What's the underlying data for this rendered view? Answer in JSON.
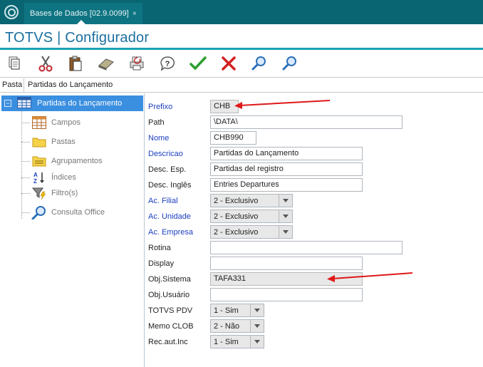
{
  "tab": {
    "label": "Bases de Dados [02.9.0099]",
    "close": "×"
  },
  "app": {
    "title": "TOTVS | Configurador"
  },
  "toolbar": {
    "icons": [
      "copy-icon",
      "cut-icon",
      "paste-icon",
      "eraser-icon",
      "print-icon",
      "help-icon",
      "confirm-icon",
      "cancel-icon",
      "search-icon",
      "search-next-icon"
    ]
  },
  "pasta": {
    "label": "Pasta",
    "value": "Partidas do Lançamento"
  },
  "tree": {
    "root": "Partidas do Lançamento",
    "children": [
      "Campos",
      "Pastas",
      "Agrupamentos",
      "Índices",
      "Filtro(s)",
      "Consulta Office"
    ]
  },
  "form": {
    "prefixo": {
      "label": "Prefixo",
      "value": "CHB"
    },
    "path": {
      "label": "Path",
      "value": "\\DATA\\"
    },
    "nome": {
      "label": "Nome",
      "value": "CHB990"
    },
    "descricao": {
      "label": "Descricao",
      "value": "Partidas do Lançamento"
    },
    "desc_esp": {
      "label": "Desc. Esp.",
      "value": "Partidas del registro"
    },
    "desc_ing": {
      "label": "Desc. Inglês",
      "value": "Entries Departures"
    },
    "ac_filial": {
      "label": "Ac. Filial",
      "value": "2 - Exclusivo"
    },
    "ac_unidade": {
      "label": "Ac. Unidade",
      "value": "2 - Exclusivo"
    },
    "ac_empresa": {
      "label": "Ac. Empresa",
      "value": "2 - Exclusivo"
    },
    "rotina": {
      "label": "Rotina",
      "value": ""
    },
    "display": {
      "label": "Display",
      "value": ""
    },
    "obj_sistema": {
      "label": "Obj.Sistema",
      "value": "TAFA331"
    },
    "obj_usuario": {
      "label": "Obj.Usuário",
      "value": ""
    },
    "totvs_pdv": {
      "label": "TOTVS PDV",
      "value": "1 - Sim"
    },
    "memo_clob": {
      "label": "Memo CLOB",
      "value": "2 - Não"
    },
    "rec_aut_inc": {
      "label": "Rec.aut.Inc",
      "value": "1 - Sim"
    }
  },
  "colors": {
    "topbar": "#0a6572",
    "accent": "#1aa3b5",
    "selection": "#3b8fe0",
    "arrow": "#e01818",
    "label_blue": "#1c3fbf"
  }
}
